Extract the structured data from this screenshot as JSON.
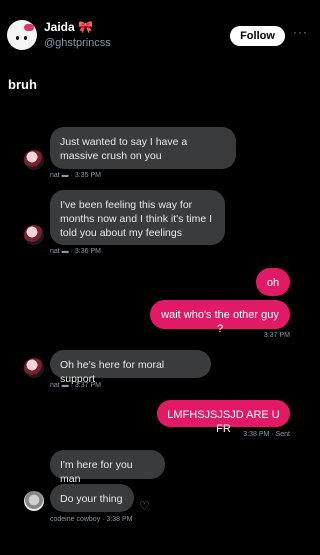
{
  "header": {
    "name": "Jaida 🎀",
    "handle": "@ghstprincss",
    "follow_label": "Follow",
    "more_label": "···"
  },
  "post": {
    "text": "bruh"
  },
  "messages": [
    {
      "from": "nat",
      "text": "Just wanted to say I have a massive crush on you"
    },
    {
      "from": "nat",
      "text": "I've been feeling this way for months now and I think it's time I told you about my feelings"
    },
    {
      "from": "me",
      "text": "oh"
    },
    {
      "from": "me",
      "text": "wait who's the other guy ?"
    },
    {
      "from": "nat",
      "text": "Oh he's here for moral support"
    },
    {
      "from": "me",
      "text": "LMFHSJSJSJD ARE U FR"
    },
    {
      "from": "codeine cowboy",
      "text": "I'm here for you man"
    },
    {
      "from": "codeine cowboy",
      "text": "Do your thing"
    }
  ],
  "meta": {
    "m1": "nat ▬ · 3:35 PM",
    "m2": "nat ▬ · 3:36 PM",
    "m4": "3:37 PM",
    "m5": "nat ▬ · 3:37 PM",
    "m6": "3:38 PM · Sent",
    "m8": "codeine cowboy · 3:38 PM"
  },
  "icons": {
    "react": "heart-plus-icon"
  },
  "colors": {
    "outgoing": "#e21a66",
    "incoming": "#3a3b3d",
    "background": "#000000"
  }
}
